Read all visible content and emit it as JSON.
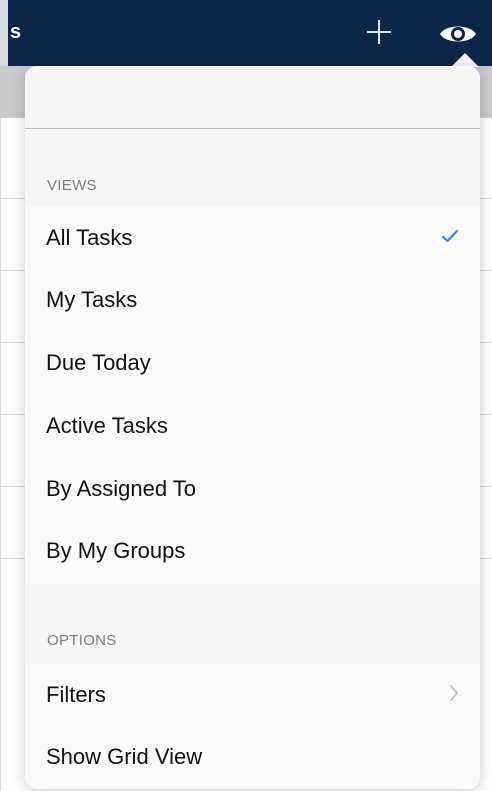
{
  "navbar": {
    "title_fragment": "s",
    "add_icon": "plus-icon",
    "view_icon": "eye-icon"
  },
  "popover": {
    "views_header": "VIEWS",
    "views": [
      {
        "label": "All Tasks",
        "selected": true
      },
      {
        "label": "My Tasks",
        "selected": false
      },
      {
        "label": "Due Today",
        "selected": false
      },
      {
        "label": "Active Tasks",
        "selected": false
      },
      {
        "label": "By Assigned To",
        "selected": false
      },
      {
        "label": "By My Groups",
        "selected": false
      }
    ],
    "options_header": "OPTIONS",
    "options": [
      {
        "label": "Filters",
        "has_disclosure": true
      },
      {
        "label": "Show Grid View",
        "has_disclosure": false
      }
    ]
  },
  "colors": {
    "navbar": "#0b2649",
    "checkmark": "#2f7bf5",
    "section_text": "#7c7c80"
  }
}
